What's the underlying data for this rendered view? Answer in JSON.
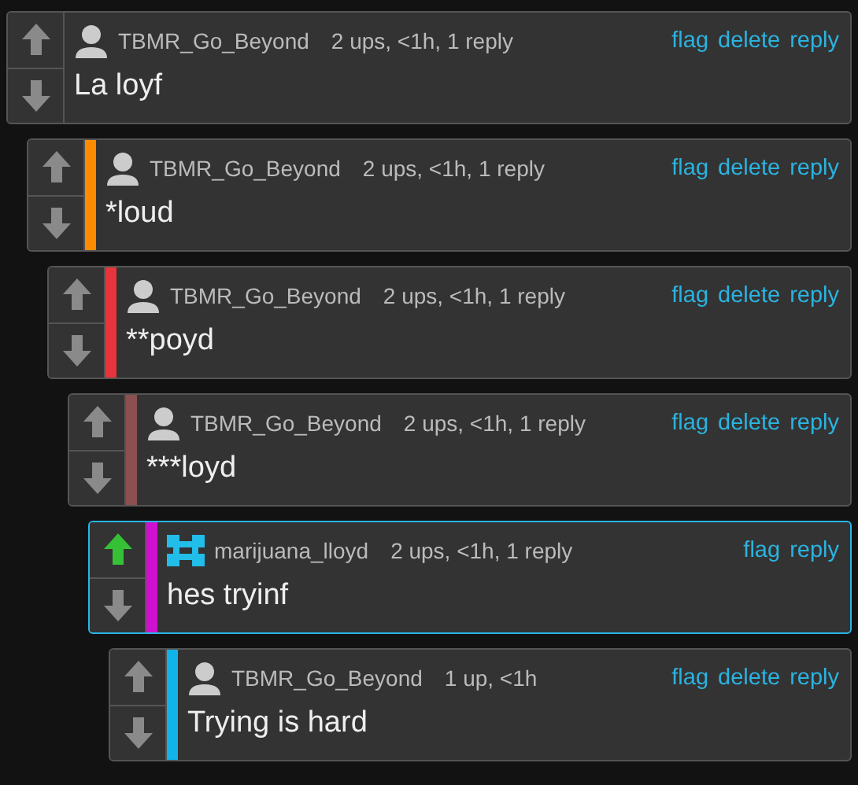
{
  "thread": [
    {
      "author": "TBMR_Go_Beyond",
      "kind": "person",
      "meta": "2 ups, <1h, 1 reply",
      "body": "La loyf",
      "upvoted": false,
      "highlighted": false,
      "actions": [
        "flag",
        "delete",
        "reply"
      ],
      "children": [
        {
          "author": "TBMR_Go_Beyond",
          "kind": "person",
          "meta": "2 ups, <1h, 1 reply",
          "body": "*loud",
          "color": "#ff8c00",
          "upvoted": false,
          "highlighted": false,
          "actions": [
            "flag",
            "delete",
            "reply"
          ],
          "children": [
            {
              "author": "TBMR_Go_Beyond",
              "kind": "person",
              "meta": "2 ups, <1h, 1 reply",
              "body": "**poyd",
              "color": "#e8343c",
              "upvoted": false,
              "highlighted": false,
              "actions": [
                "flag",
                "delete",
                "reply"
              ],
              "children": [
                {
                  "author": "TBMR_Go_Beyond",
                  "kind": "person",
                  "meta": "2 ups, <1h, 1 reply",
                  "body": "***loyd",
                  "color": "#8c5050",
                  "upvoted": false,
                  "highlighted": false,
                  "actions": [
                    "flag",
                    "delete",
                    "reply"
                  ],
                  "children": [
                    {
                      "author": "marijuana_lloyd",
                      "kind": "pattern",
                      "meta": "2 ups, <1h, 1 reply",
                      "body": "hes tryinf",
                      "color": "#d010d0",
                      "upvoted": true,
                      "highlighted": true,
                      "actions": [
                        "flag",
                        "reply"
                      ],
                      "children": [
                        {
                          "author": "TBMR_Go_Beyond",
                          "kind": "person",
                          "meta": "1 up, <1h",
                          "body": "Trying is hard",
                          "color": "#10b4e8",
                          "upvoted": false,
                          "highlighted": false,
                          "actions": [
                            "flag",
                            "delete",
                            "reply"
                          ]
                        }
                      ]
                    }
                  ]
                }
              ]
            }
          ]
        }
      ]
    }
  ]
}
